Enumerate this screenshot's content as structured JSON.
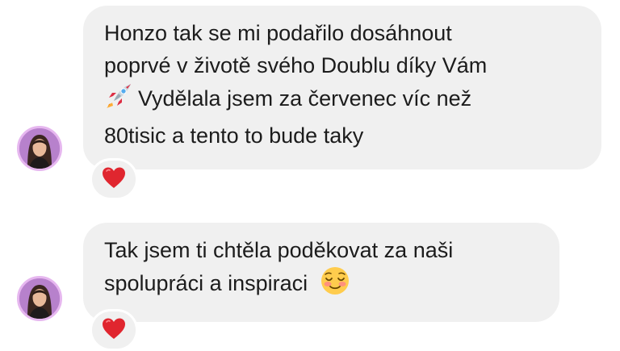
{
  "messages": [
    {
      "lines": [
        "Honzo tak se mi podařilo dosáhnout",
        "poprvé v životě svého Doublu díky Vám",
        "Vydělala jsem za červenec víc než",
        "80tisic a tento to bude taky"
      ],
      "inline_emoji": "rocket-icon",
      "reaction": "heart-icon"
    },
    {
      "lines": [
        "Tak jsem ti chtěla poděkovat za naši",
        "spolupráci a inspiraci"
      ],
      "inline_emoji": "smiling-face-icon",
      "reaction": "heart-icon"
    }
  ],
  "colors": {
    "bubble_bg": "#f0f0f0",
    "text": "#1c1c1c",
    "heart": "#e0262f",
    "avatar_ring": "#c48ad6"
  }
}
